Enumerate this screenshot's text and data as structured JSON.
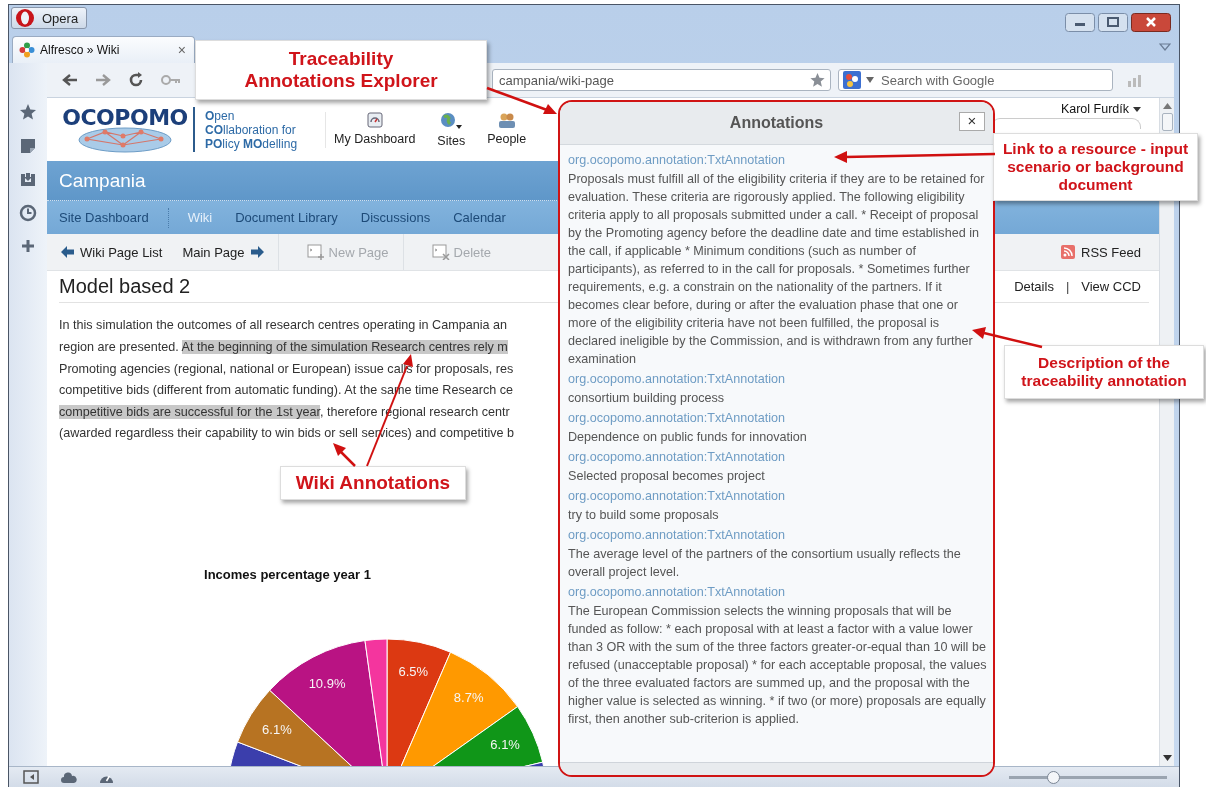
{
  "window": {
    "title": "Opera",
    "tab": {
      "title": "Alfresco » Wiki",
      "close": "×"
    }
  },
  "address_bar": {
    "url": "campania/wiki-page",
    "search_placeholder": "Search with Google"
  },
  "header": {
    "logo": "OCOPOMO",
    "tagline": [
      "**O**pen",
      "**CO**llaboration for",
      "**PO**licy **MO**delling"
    ],
    "nav": [
      {
        "kind": "dashboard",
        "label": "My Dashboard"
      },
      {
        "kind": "sites",
        "label": "Sites"
      },
      {
        "kind": "people",
        "label": "People"
      }
    ],
    "user": "Karol Furdík"
  },
  "site": {
    "title": "Campania",
    "nav": [
      {
        "label": "Site Dashboard",
        "selected": false
      },
      {
        "label": "Wiki",
        "selected": true
      },
      {
        "label": "Document Library",
        "selected": false
      },
      {
        "label": "Discussions",
        "selected": false
      },
      {
        "label": "Calendar",
        "selected": false
      }
    ]
  },
  "toolbar": {
    "back_link": "Wiki Page List",
    "forward_link": "Main Page",
    "actions": [
      {
        "kind": "new",
        "label": "New Page",
        "disabled": true
      },
      {
        "kind": "delete",
        "label": "Delete",
        "disabled": true
      }
    ],
    "rss": "RSS Feed"
  },
  "page": {
    "title": "Model based 2",
    "links": [
      "Details",
      "View CCD"
    ],
    "separator": "|",
    "paragraph_lines": [
      [
        {
          "text": "In this simulation the outcomes of all research centres operating in Campania an",
          "highlighted": false
        }
      ],
      [
        {
          "text": "region are presented. ",
          "highlighted": false
        },
        {
          "text": "At the beginning of the simulation Research centres rely m",
          "highlighted": true
        }
      ],
      [
        {
          "text": "Promoting agencies (regional, national or European) issue calls for proposals, res",
          "highlighted": false
        }
      ],
      [
        {
          "text": "competitive bids (different from automatic funding). At the same time Research ce",
          "highlighted": false
        }
      ],
      [
        {
          "text": "competitive bids are successful for the 1st year",
          "highlighted": true
        },
        {
          "text": ", therefore regional research centr",
          "highlighted": false
        }
      ],
      [
        {
          "text": "(awarded regardless their capability to win bids or sell services) and competitive b",
          "highlighted": false
        }
      ]
    ],
    "chart_data": {
      "type": "pie",
      "title": "Incomes percentage year 1",
      "values": [
        6.5,
        8.7,
        6.1,
        59.5,
        6.1,
        10.9,
        2.2
      ],
      "colors": [
        "#dc3912",
        "#ff9900",
        "#109618",
        "#3b3eac",
        "#b77322",
        "#b91383",
        "#f4359e"
      ],
      "value_labels": [
        "6.5%",
        "8.7%",
        "6.1%",
        null,
        "6.1%",
        "10.9%",
        null
      ]
    }
  },
  "annotations_panel": {
    "title": "Annotations",
    "close": "×",
    "items": [
      {
        "link": "org.ocopomo.annotation:TxtAnnotation",
        "text": "Proposals must fulfill all of the eligibility criteria if they are to be retained for evaluation. These criteria are rigorously applied. The following eligibility criteria apply to all proposals submitted under a call. * Receipt of proposal by the Promoting agency before the deadline date and time established in the call, if applicable * Minimum conditions (such as number of participants), as referred to in the call for proposals. * Sometimes further requirements, e.g. a constrain on the nationality of the partners. If it becomes clear before, during or after the evaluation phase that one or more of the eligibility criteria have not been fulfilled, the proposal is declared ineligible by the Commission, and is withdrawn from any further examination"
      },
      {
        "link": "org.ocopomo.annotation:TxtAnnotation",
        "text": "consortium building process"
      },
      {
        "link": "org.ocopomo.annotation:TxtAnnotation",
        "text": "Dependence on public funds for innovation"
      },
      {
        "link": "org.ocopomo.annotation:TxtAnnotation",
        "text": "Selected proposal becomes project"
      },
      {
        "link": "org.ocopomo.annotation:TxtAnnotation",
        "text": "try to build some proposals"
      },
      {
        "link": "org.ocopomo.annotation:TxtAnnotation",
        "text": "The average level of the partners of the consortium usually reflects the overall project level."
      },
      {
        "link": "org.ocopomo.annotation:TxtAnnotation",
        "text": "The European Commission selects the winning proposals that will be funded as follow: * each proposal with at least a factor with a value lower than 3 OR with the sum of the three factors greater-or-equal than 10 will be refused (unacceptable proposal) * for each acceptable proposal, the values of the three evaluated factors are summed up, and the proposal with the higher value is selected as winning. * if two (or more) proposals are equally first, then another sub-criterion is applied."
      }
    ]
  },
  "callouts": [
    {
      "kind": "explorer",
      "text": "Traceability Annotations Explorer"
    },
    {
      "kind": "link",
      "text": "Link to a resource - input scenario or background document"
    },
    {
      "kind": "description",
      "text": "Description of the traceability annotation"
    },
    {
      "kind": "wiki",
      "text": "Wiki Annotations"
    }
  ],
  "status_bar": {
    "zoom": {
      "level": 0.28
    }
  }
}
